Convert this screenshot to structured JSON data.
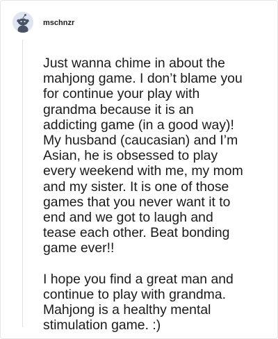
{
  "comment": {
    "author": {
      "username": "mschnzr",
      "avatar_icon": "snoo-avatar-icon",
      "avatar_background": "#dfe4f1"
    },
    "paragraphs": [
      "Just wanna chime in about the\nmahjong game. I don’t blame you\nfor continue your play with\ngrandma because it is an\naddicting game (in a good way)!\nMy husband (caucasian) and I’m\nAsian, he is obsessed to play\nevery weekend with me, my mom\nand my sister. It is one of those\ngames that you never want it to\nend and we got to laugh and\ntease each other. Beat bonding\ngame ever!!",
      "I hope you find a great man and\ncontinue to play with grandma.\nMahjong is a healthy mental\nstimulation game. :)"
    ]
  }
}
